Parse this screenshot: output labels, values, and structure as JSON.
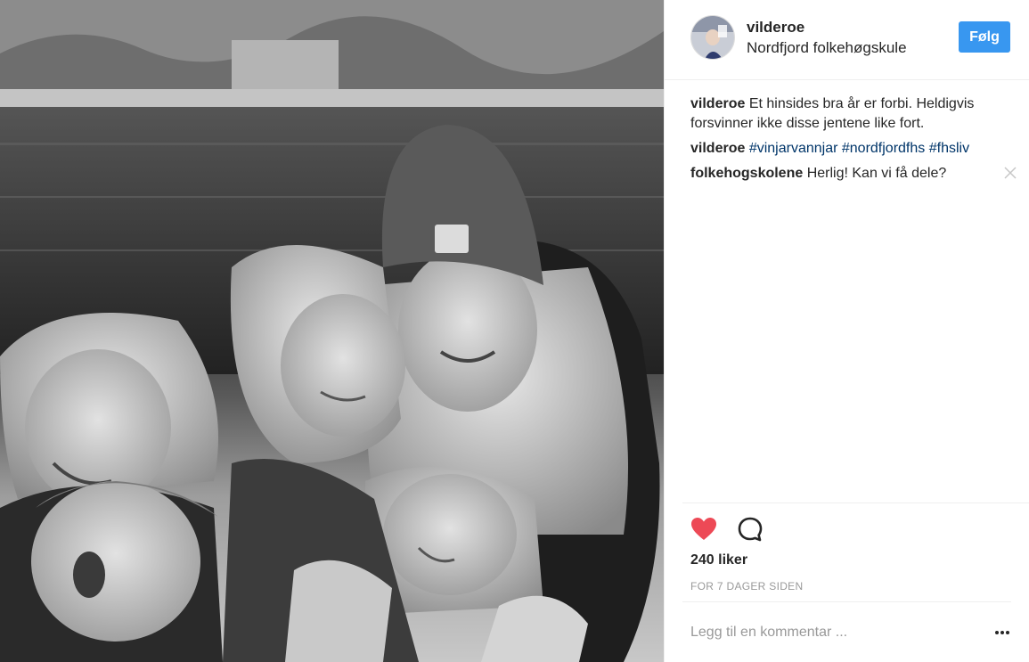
{
  "post": {
    "author": {
      "username": "vilderoe",
      "location": "Nordfjord folkehøgskule"
    },
    "follow_button_label": "Følg",
    "comments": [
      {
        "user": "vilderoe",
        "text": "Et hinsides bra år er forbi. Heldigvis forsvinner ikke disse jentene like fort."
      },
      {
        "user": "vilderoe",
        "hashtags": [
          "#vinjarvannjar",
          "#nordfjordfhs",
          "#fhsliv"
        ]
      },
      {
        "user": "folkehogskolene",
        "text": "Herlig! Kan vi få dele?"
      }
    ],
    "likes_text": "240 liker",
    "timestamp": "FOR 7 DAGER SIDEN",
    "add_comment_placeholder": "Legg til en kommentar ...",
    "liked": true
  },
  "icons": {
    "like": "heart-icon",
    "comment": "comment-bubble-icon",
    "remove_comment": "close-icon",
    "more": "more-options-icon"
  },
  "colors": {
    "follow_button": "#3897f0",
    "liked_heart": "#ed4956",
    "hashtag": "#003569",
    "muted_text": "#999999"
  }
}
